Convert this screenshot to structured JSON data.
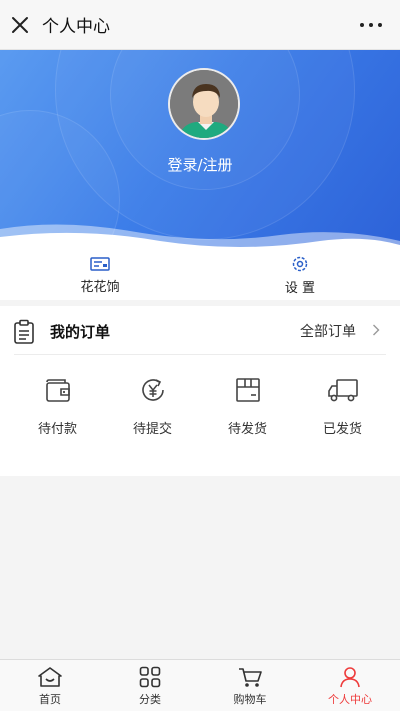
{
  "titlebar": {
    "title": "个人中心"
  },
  "profile": {
    "login_label": "登录/注册"
  },
  "quick_links": [
    {
      "label": "花花饷",
      "icon": "wallet-card-icon"
    },
    {
      "label": "设 置",
      "icon": "gear-icon"
    }
  ],
  "orders": {
    "title": "我的订单",
    "all_label": "全部订单",
    "items": [
      {
        "label": "待付款",
        "icon": "wallet-icon"
      },
      {
        "label": "待提交",
        "icon": "yuan-cycle-icon"
      },
      {
        "label": "待发货",
        "icon": "package-icon"
      },
      {
        "label": "已发货",
        "icon": "truck-icon"
      }
    ]
  },
  "tabbar": {
    "tabs": [
      {
        "label": "首页",
        "icon": "home-icon",
        "active": false
      },
      {
        "label": "分类",
        "icon": "grid-icon",
        "active": false
      },
      {
        "label": "购物车",
        "icon": "cart-icon",
        "active": false
      },
      {
        "label": "个人中心",
        "icon": "user-icon",
        "active": true
      }
    ]
  },
  "colors": {
    "accent_blue": "#3d7ee9",
    "active_tab": "#ee3b3b"
  }
}
